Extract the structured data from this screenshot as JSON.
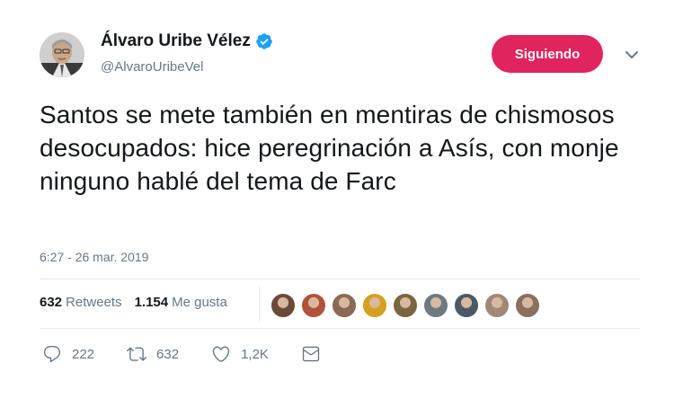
{
  "author": {
    "display_name": "Álvaro Uribe Vélez",
    "handle": "@AlvaroUribeVel",
    "verified_icon": "verified-badge-icon"
  },
  "follow_button": {
    "label": "Siguiendo",
    "color": "#e0245e"
  },
  "tweet": {
    "text": "Santos se mete también en mentiras de chismosos desocupados: hice peregrinación a Asís, con monje ninguno hablé del tema de Farc",
    "timestamp": "6:27 - 26 mar. 2019"
  },
  "stats": {
    "retweets_count": "632",
    "retweets_label": "Retweets",
    "likes_count": "1.154",
    "likes_label": "Me gusta"
  },
  "likers": [
    {
      "name": "liker-avatar",
      "color": "#6b4a3a"
    },
    {
      "name": "liker-avatar",
      "color": "#b0533a"
    },
    {
      "name": "liker-avatar",
      "color": "#8a6a55"
    },
    {
      "name": "liker-avatar",
      "color": "#d4a020"
    },
    {
      "name": "liker-avatar",
      "color": "#7a6540"
    },
    {
      "name": "liker-avatar",
      "color": "#6d7a80"
    },
    {
      "name": "liker-avatar",
      "color": "#4a5a68"
    },
    {
      "name": "liker-avatar",
      "color": "#a08878"
    },
    {
      "name": "liker-avatar",
      "color": "#8a7060"
    }
  ],
  "actions": {
    "reply_count": "222",
    "retweet_count": "632",
    "like_count": "1,2K",
    "icons": [
      "reply-icon",
      "retweet-icon",
      "like-icon",
      "message-icon"
    ]
  },
  "colors": {
    "text": "#14171a",
    "secondary": "#657786",
    "verified": "#1da1f2",
    "divider": "#e6ecf0"
  }
}
